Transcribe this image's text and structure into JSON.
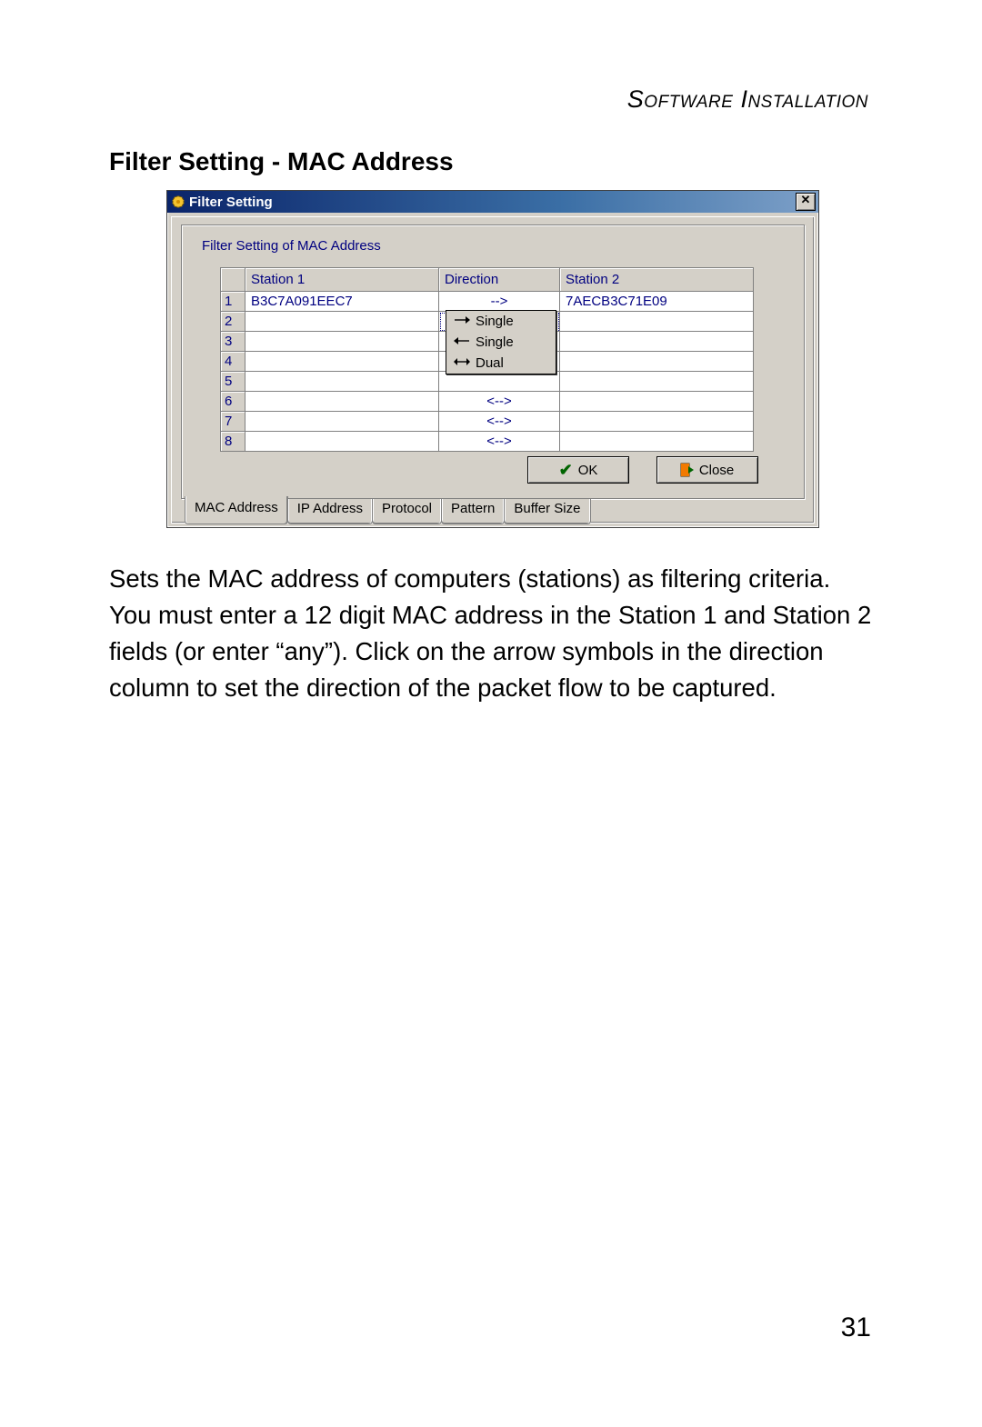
{
  "doc": {
    "header": "Software Installation",
    "title": "Filter Setting - MAC Address",
    "body": "Sets the MAC address of computers (stations) as filtering criteria. You must enter a 12 digit MAC address in the Station 1 and Station 2 fields (or enter “any”). Click on the arrow symbols in the direction column to set the direction of the packet flow to be captured.",
    "page_number": "31"
  },
  "dialog": {
    "title": "Filter Setting",
    "panel_label": "Filter Setting of MAC Address",
    "columns": {
      "station1": "Station 1",
      "direction": "Direction",
      "station2": "Station 2"
    },
    "rows": [
      {
        "n": "1",
        "s1": "B3C7A091EEC7",
        "dir": "-->",
        "s2": "7AECB3C71E09"
      },
      {
        "n": "2",
        "s1": "",
        "dir": "<-->",
        "s2": ""
      },
      {
        "n": "3",
        "s1": "",
        "dir": "",
        "s2": ""
      },
      {
        "n": "4",
        "s1": "",
        "dir": "",
        "s2": ""
      },
      {
        "n": "5",
        "s1": "",
        "dir": "",
        "s2": ""
      },
      {
        "n": "6",
        "s1": "",
        "dir": "<-->",
        "s2": ""
      },
      {
        "n": "7",
        "s1": "",
        "dir": "<-->",
        "s2": ""
      },
      {
        "n": "8",
        "s1": "",
        "dir": "<-->",
        "s2": ""
      }
    ],
    "dropdown": {
      "opt_single_right": "Single",
      "opt_single_left": "Single",
      "opt_dual": "Dual"
    },
    "buttons": {
      "ok": "OK",
      "close": "Close"
    },
    "tabs": {
      "mac": "MAC Address",
      "ip": "IP Address",
      "protocol": "Protocol",
      "pattern": "Pattern",
      "buffer": "Buffer Size"
    }
  }
}
